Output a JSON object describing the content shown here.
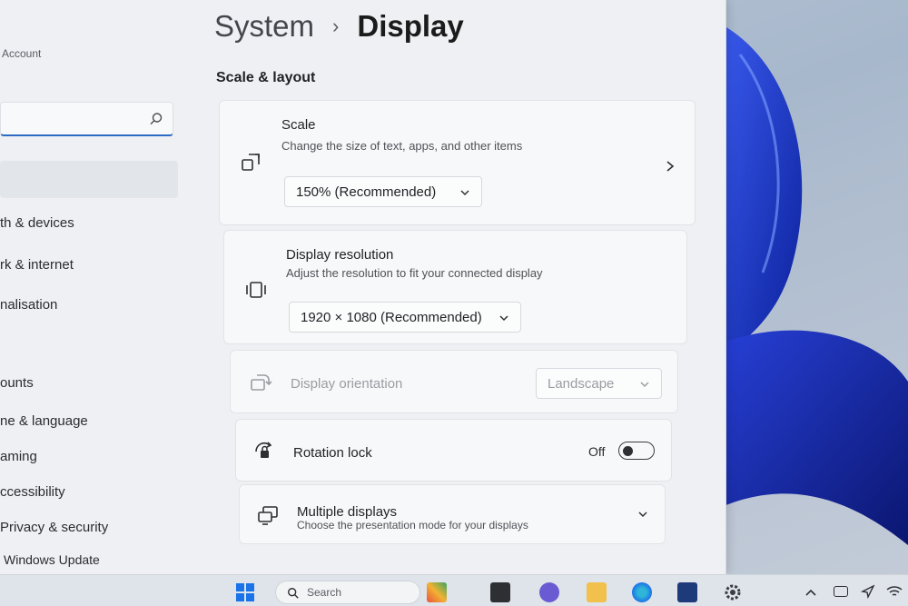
{
  "sidebar": {
    "account_label": "Account",
    "search_placeholder": "",
    "items": [
      {
        "label": "th & devices"
      },
      {
        "label": "rk & internet"
      },
      {
        "label": "nalisation"
      },
      {
        "label": "ounts"
      },
      {
        "label": "ne & language"
      },
      {
        "label": "aming"
      },
      {
        "label": "ccessibility"
      },
      {
        "label": "Privacy & security"
      },
      {
        "label": "Windows Update"
      }
    ]
  },
  "header": {
    "parent": "System",
    "separator": "›",
    "current": "Display"
  },
  "section_title": "Scale & layout",
  "cards": {
    "scale": {
      "title": "Scale",
      "subtitle": "Change the size of text, apps, and other items",
      "value": "150% (Recommended)"
    },
    "resolution": {
      "title": "Display resolution",
      "subtitle": "Adjust the resolution to fit your connected display",
      "value": "1920 × 1080 (Recommended)"
    },
    "orientation": {
      "title": "Display orientation",
      "value": "Landscape"
    },
    "rotation_lock": {
      "title": "Rotation lock",
      "state_label": "Off",
      "state": false
    },
    "multiple_displays": {
      "title": "Multiple displays",
      "subtitle": "Choose the presentation mode for your displays"
    }
  },
  "taskbar": {
    "search_label": "Search"
  },
  "colors": {
    "accent": "#2b6bc4",
    "wallpaper_bloom": "#1f3fd6"
  }
}
